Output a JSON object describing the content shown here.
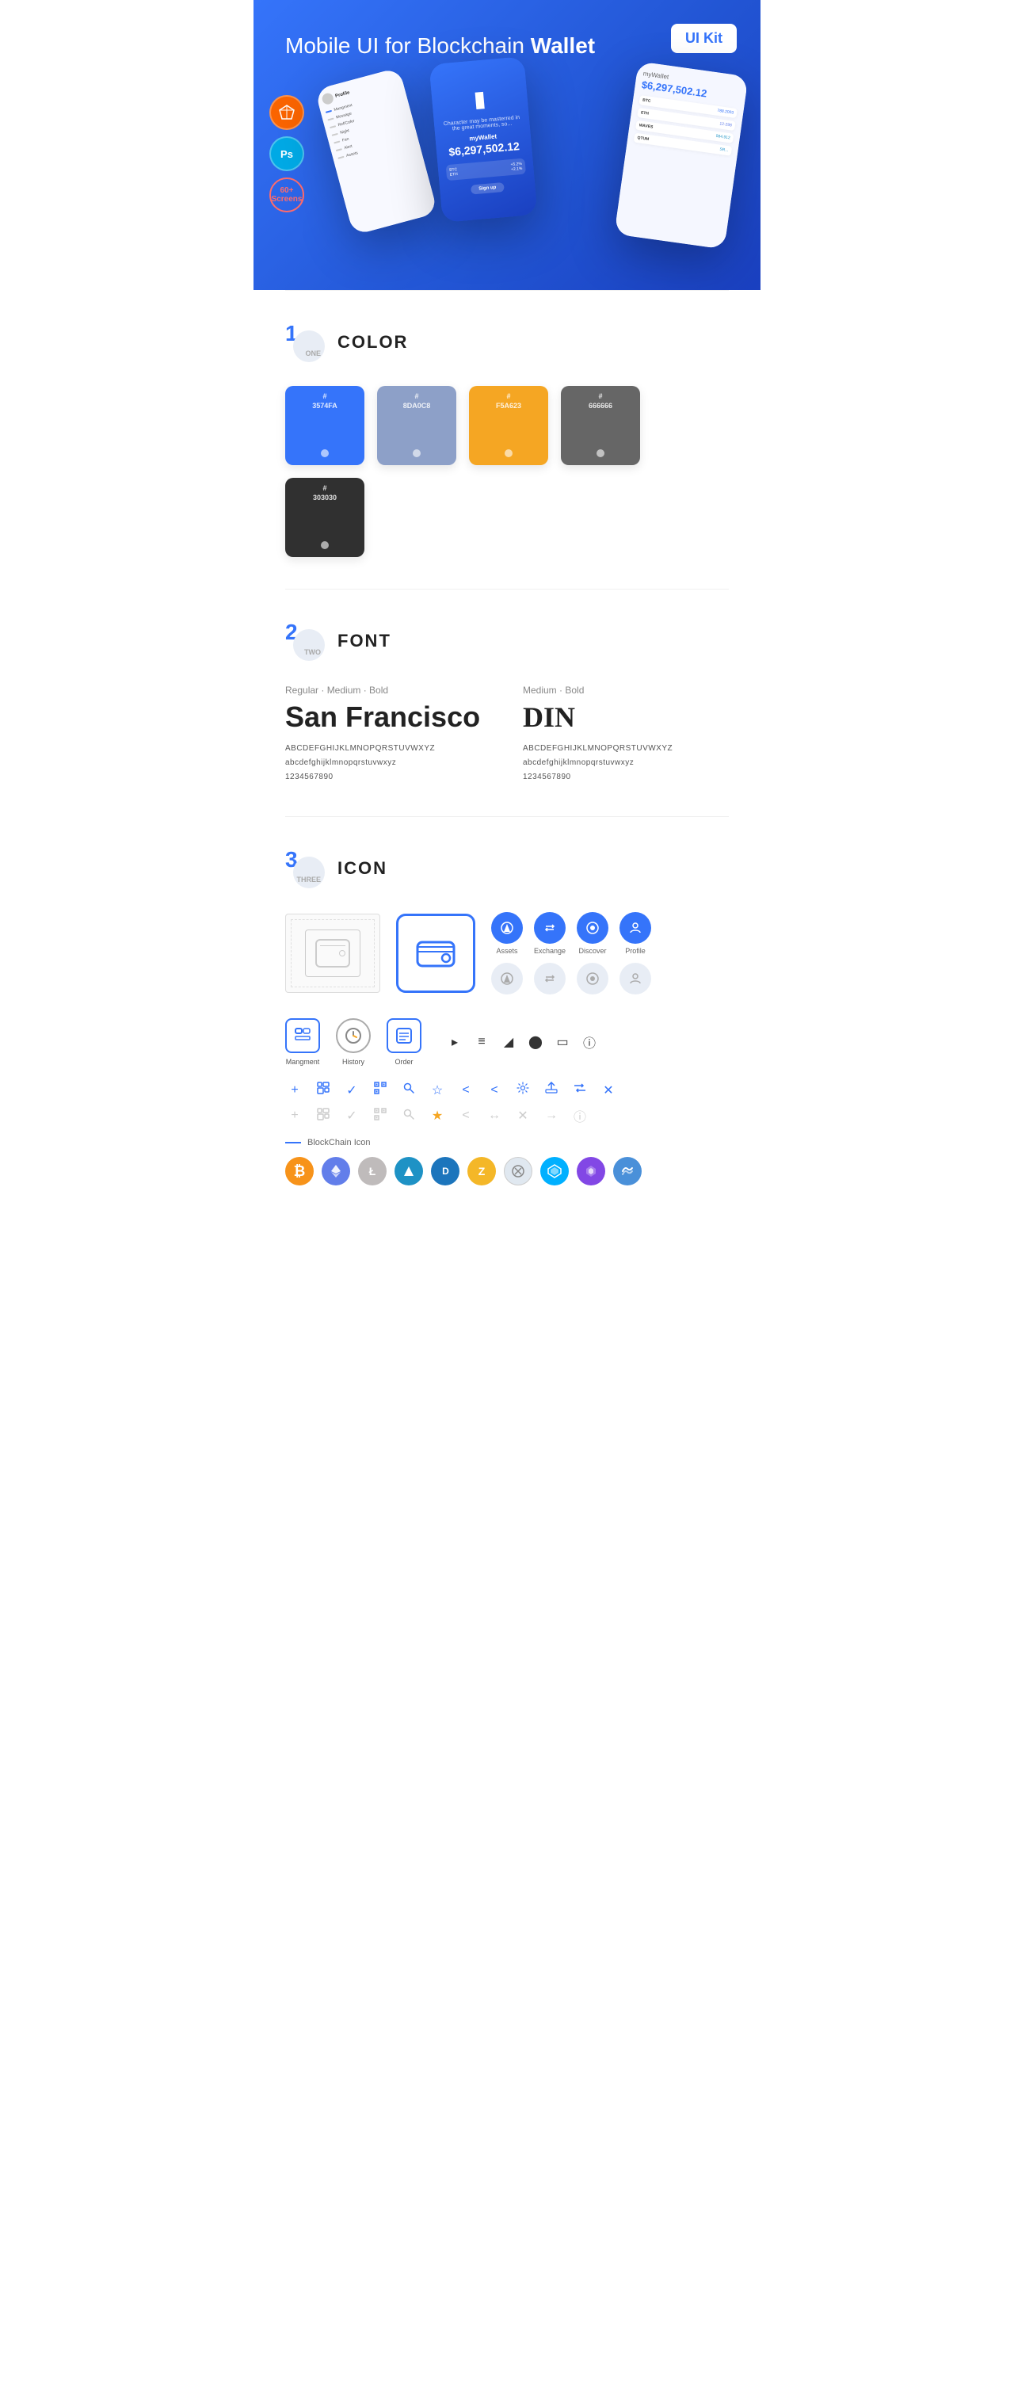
{
  "hero": {
    "title": "Mobile UI for Blockchain ",
    "title_bold": "Wallet",
    "badge": "UI Kit",
    "badges": [
      {
        "label": "S",
        "type": "sketch"
      },
      {
        "label": "Ps",
        "type": "ps"
      },
      {
        "label": "60+\nScreens",
        "type": "screens"
      }
    ]
  },
  "sections": {
    "color": {
      "number": "1",
      "sub": "ONE",
      "title": "COLOR",
      "swatches": [
        {
          "hex": "#3574FA",
          "label": "#\n3574FA",
          "dark": false
        },
        {
          "hex": "#8DA0C8",
          "label": "#\n8DA0C8",
          "dark": false
        },
        {
          "hex": "#F5A623",
          "label": "#\nF5A623",
          "dark": false
        },
        {
          "hex": "#666666",
          "label": "#\n666666",
          "dark": false
        },
        {
          "hex": "#303030",
          "label": "#\n303030",
          "dark": false
        }
      ]
    },
    "font": {
      "number": "2",
      "sub": "TWO",
      "title": "FONT",
      "fonts": [
        {
          "style_label": "Regular · Medium · Bold",
          "name": "San Francisco",
          "upper": "ABCDEFGHIJKLMNOPQRSTUVWXYZ",
          "lower": "abcdefghijklmnopqrstuvwxyz",
          "nums": "1234567890"
        },
        {
          "style_label": "Medium · Bold",
          "name": "DIN",
          "upper": "ABCDEFGHIJKLMNOPQRSTUVWXYZ",
          "lower": "abcdefghijklmnopqrstuvwxyz",
          "nums": "1234567890"
        }
      ]
    },
    "icon": {
      "number": "3",
      "sub": "THREE",
      "title": "ICON",
      "nav_icons": [
        {
          "label": "Assets",
          "filled": true
        },
        {
          "label": "Exchange",
          "filled": true
        },
        {
          "label": "Discover",
          "filled": true
        },
        {
          "label": "Profile",
          "filled": true
        }
      ],
      "nav_icons_gray": [
        {
          "label": "",
          "filled": false
        },
        {
          "label": "",
          "filled": false
        },
        {
          "label": "",
          "filled": false
        },
        {
          "label": "",
          "filled": false
        }
      ],
      "bottom_icons": [
        {
          "label": "Mangment",
          "type": "square"
        },
        {
          "label": "History",
          "type": "clock"
        },
        {
          "label": "Order",
          "type": "list"
        }
      ],
      "misc_icons_row1": [
        "+",
        "⊞",
        "✓",
        "⊞",
        "🔍",
        "☆",
        "<",
        "⟨",
        "⚙",
        "⊡",
        "⇄",
        "✕"
      ],
      "misc_icons_row2": [
        "+",
        "⊞",
        "✓",
        "⊞",
        "⟳",
        "☆",
        "<",
        "↔",
        "✕",
        "→",
        "ⓘ"
      ],
      "blockchain_label": "BlockChain Icon",
      "crypto_icons": [
        {
          "symbol": "₿",
          "color": "#F7931A",
          "name": "Bitcoin"
        },
        {
          "symbol": "Ξ",
          "color": "#627EEA",
          "name": "Ethereum"
        },
        {
          "symbol": "Ł",
          "color": "#BFBBBB",
          "name": "Litecoin"
        },
        {
          "symbol": "◆",
          "color": "#1E92C5",
          "name": "Waves"
        },
        {
          "symbol": "Đ",
          "color": "#1C75BC",
          "name": "Dash"
        },
        {
          "symbol": "Z",
          "color": "#F4B728",
          "name": "Zcash"
        },
        {
          "symbol": "◈",
          "color": "#242424",
          "name": "IOTA"
        },
        {
          "symbol": "▲",
          "color": "#2E9AD0",
          "name": "QTUM"
        },
        {
          "symbol": "◇",
          "color": "#8247E5",
          "name": "Matic"
        },
        {
          "symbol": "~",
          "color": "#00C8FF",
          "name": "Sky"
        }
      ]
    }
  }
}
